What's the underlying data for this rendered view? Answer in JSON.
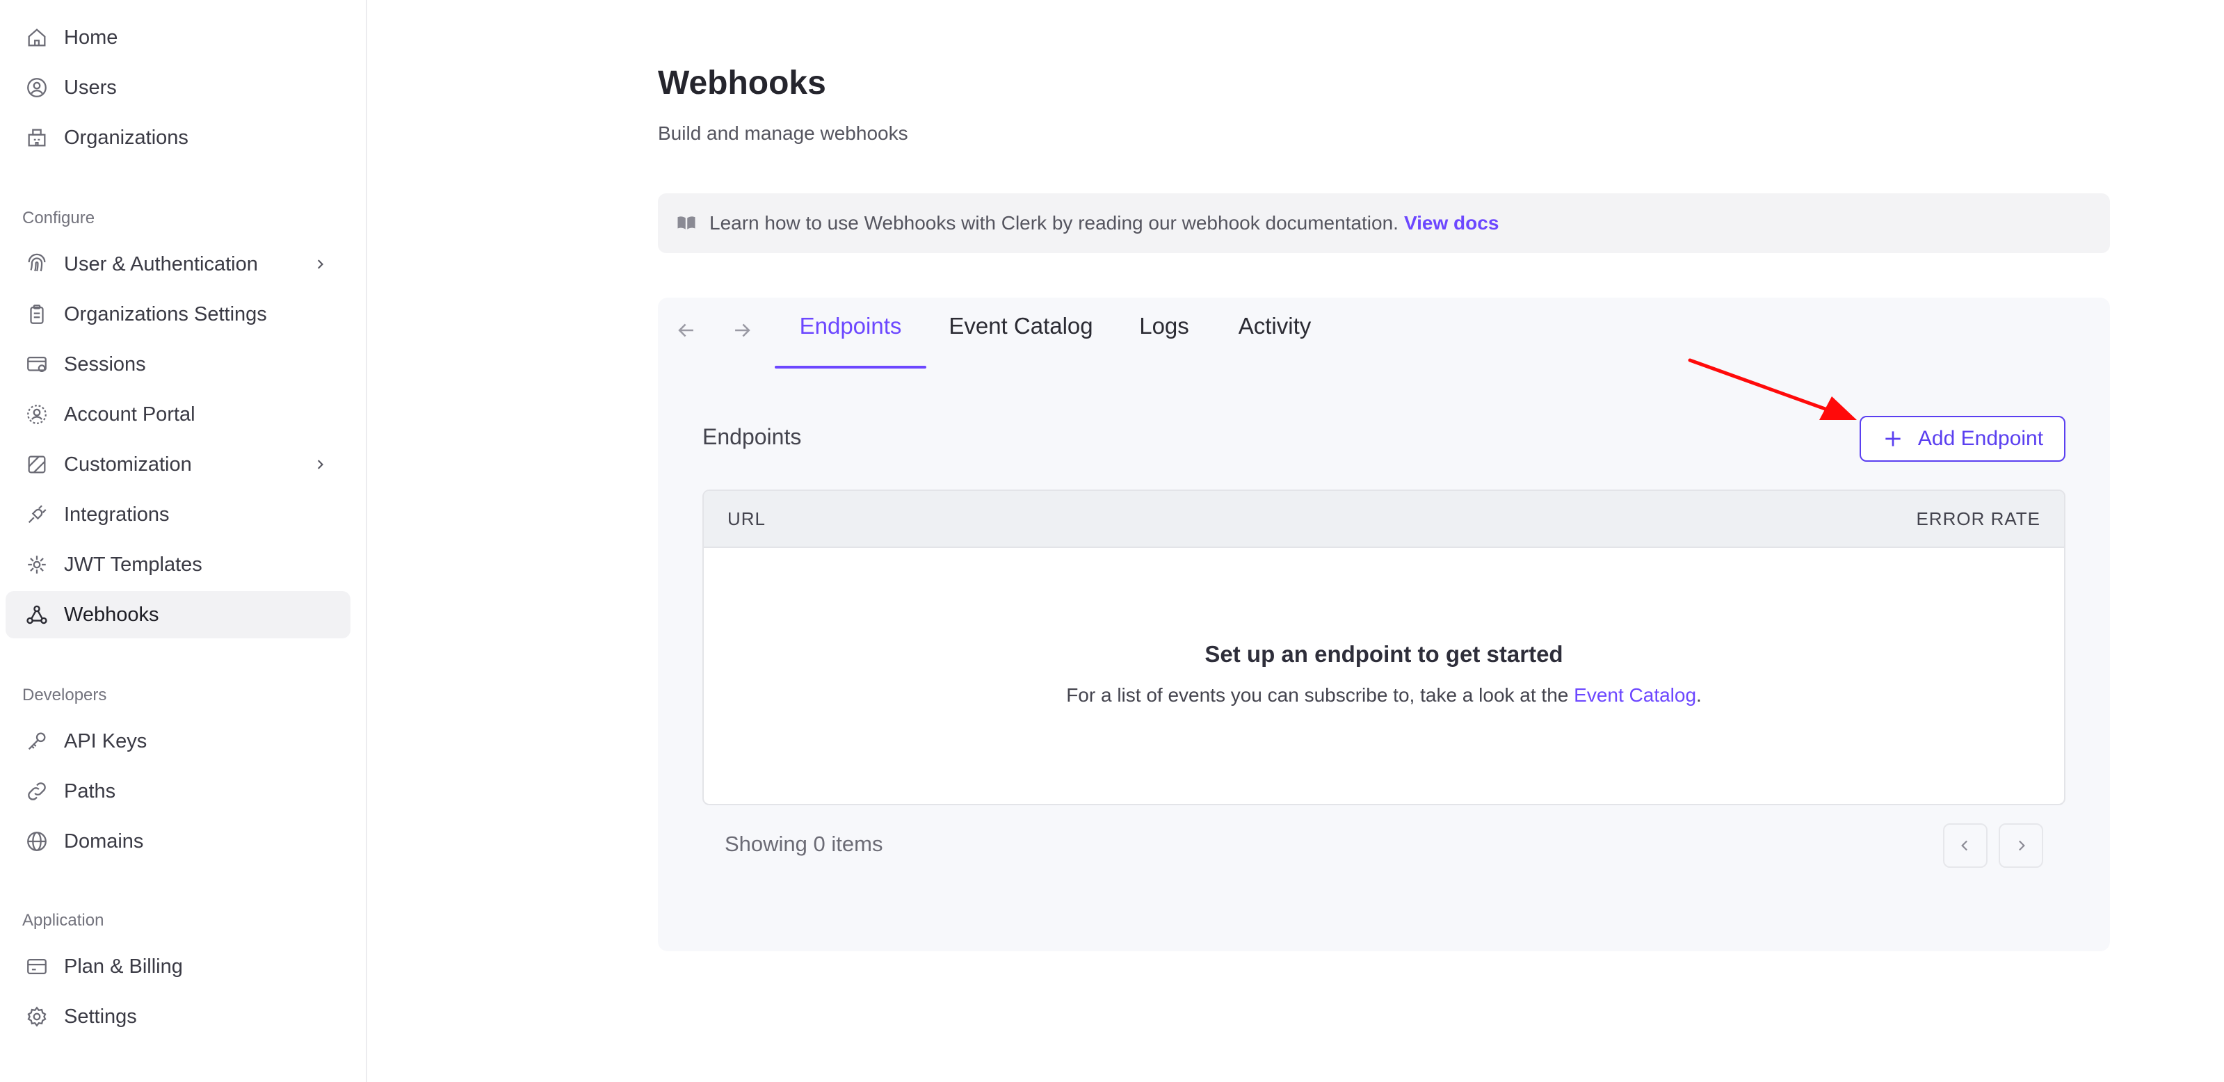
{
  "sidebar": {
    "top_items": [
      {
        "label": "Home",
        "icon": "home-icon"
      },
      {
        "label": "Users",
        "icon": "user-circle-icon"
      },
      {
        "label": "Organizations",
        "icon": "building-icon"
      }
    ],
    "configure_label": "Configure",
    "configure_items": [
      {
        "label": "User & Authentication",
        "icon": "fingerprint-icon",
        "has_submenu": true
      },
      {
        "label": "Organizations Settings",
        "icon": "clipboard-icon"
      },
      {
        "label": "Sessions",
        "icon": "session-icon"
      },
      {
        "label": "Account Portal",
        "icon": "portal-icon"
      },
      {
        "label": "Customization",
        "icon": "palette-icon",
        "has_submenu": true
      },
      {
        "label": "Integrations",
        "icon": "plug-icon"
      },
      {
        "label": "JWT Templates",
        "icon": "jwt-icon"
      },
      {
        "label": "Webhooks",
        "icon": "webhook-icon",
        "active": true
      }
    ],
    "developers_label": "Developers",
    "developers_items": [
      {
        "label": "API Keys",
        "icon": "key-icon"
      },
      {
        "label": "Paths",
        "icon": "link-icon"
      },
      {
        "label": "Domains",
        "icon": "globe-icon"
      }
    ],
    "application_label": "Application",
    "application_items": [
      {
        "label": "Plan & Billing",
        "icon": "credit-card-icon"
      },
      {
        "label": "Settings",
        "icon": "gear-icon"
      }
    ]
  },
  "header": {
    "title": "Webhooks",
    "subtitle": "Build and manage webhooks"
  },
  "banner": {
    "text": "Learn how to use Webhooks with Clerk by reading our webhook documentation.",
    "link": "View docs"
  },
  "tabs": [
    {
      "label": "Endpoints",
      "active": true
    },
    {
      "label": "Event Catalog"
    },
    {
      "label": "Logs"
    },
    {
      "label": "Activity"
    }
  ],
  "endpoints": {
    "section_label": "Endpoints",
    "add_button": "Add Endpoint",
    "table": {
      "col_url": "URL",
      "col_error_rate": "ERROR RATE"
    },
    "empty_title": "Set up an endpoint to get started",
    "empty_desc_prefix": "For a list of events you can subscribe to, take a look at the",
    "empty_desc_link": "Event Catalog",
    "empty_desc_suffix": ".",
    "showing": "Showing 0 items"
  },
  "colors": {
    "accent": "#6c47ff",
    "annotation_arrow": "#ff0000"
  }
}
